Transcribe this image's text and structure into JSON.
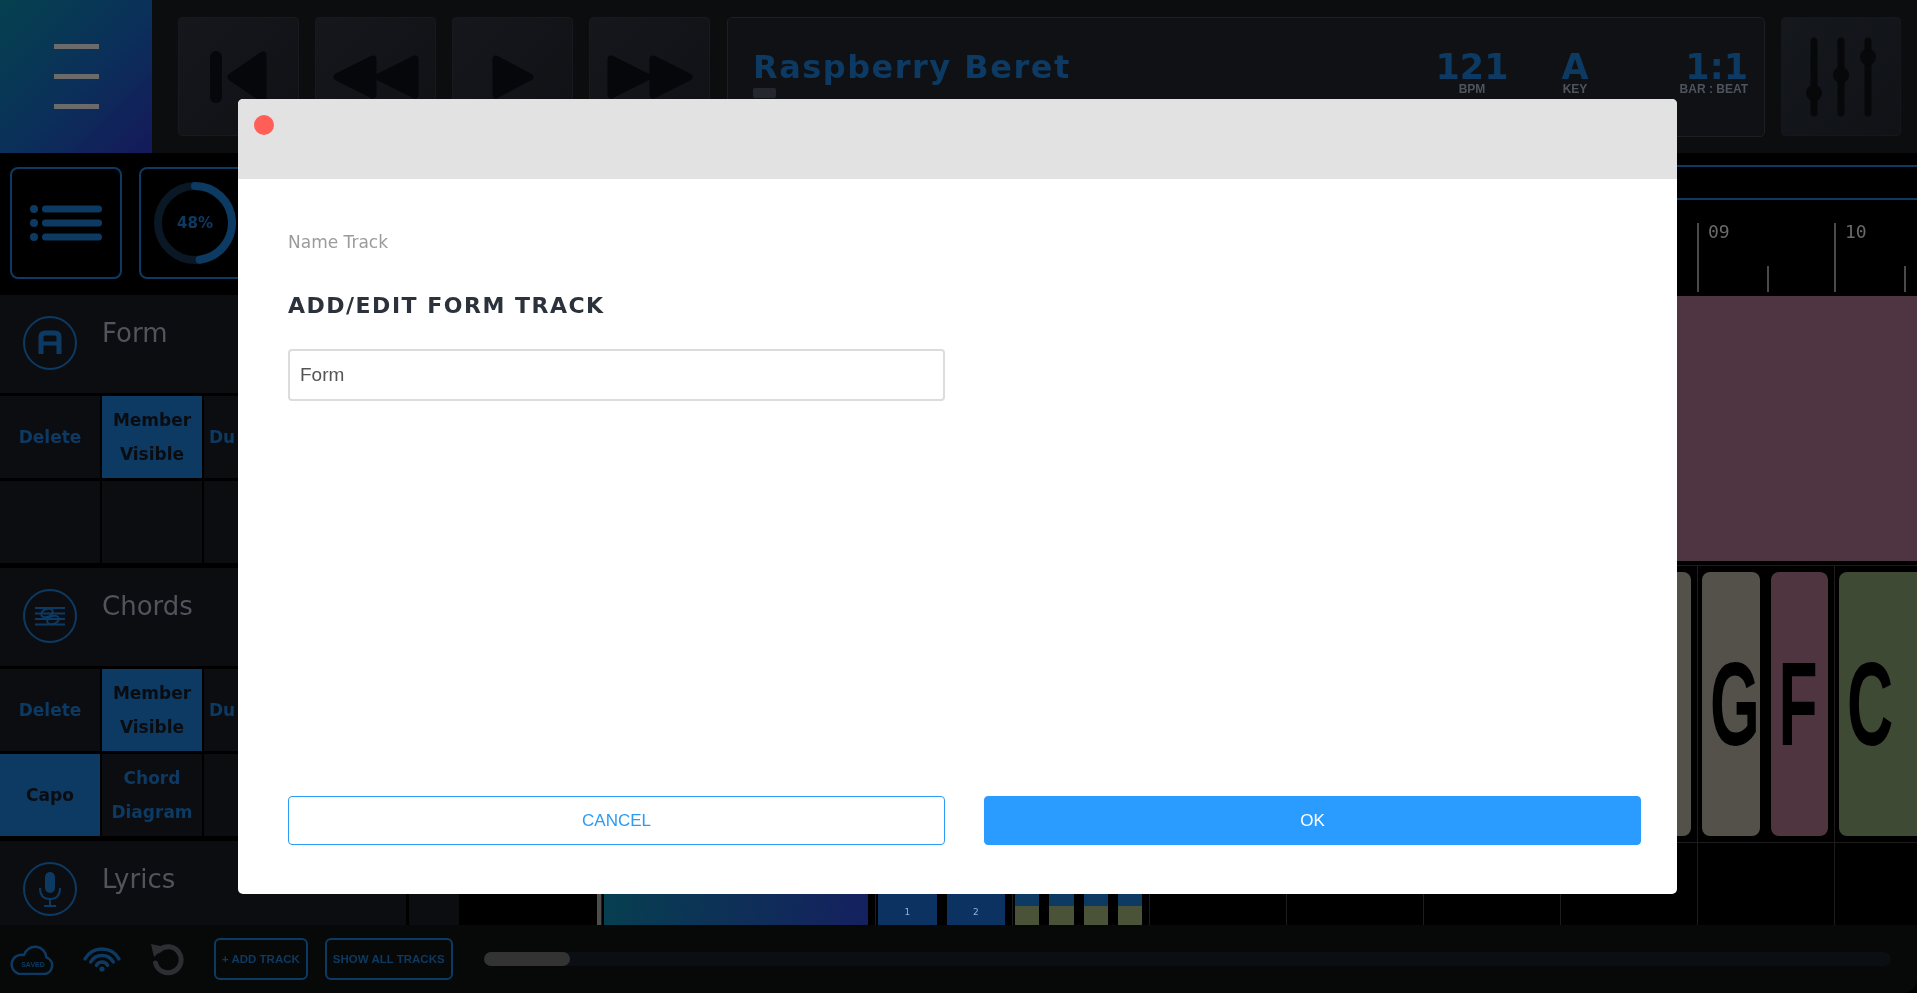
{
  "top_bar": {
    "song": {
      "title": "Raspberry Beret",
      "readouts": [
        {
          "value": "121",
          "label": "BPM"
        },
        {
          "value": "A",
          "label": "KEY"
        },
        {
          "value": "1:1",
          "label": "BAR : BEAT"
        }
      ]
    }
  },
  "sidebar": {
    "load": {
      "level": 0.48,
      "reading": "48%"
    },
    "tracks": [
      {
        "kind": "form",
        "name": "Form",
        "option_rows": [
          [
            {
              "label": "Delete",
              "on": false
            },
            {
              "label": "Member Visible",
              "on": true
            },
            {
              "label": "Du",
              "on": false
            }
          ],
          [
            {
              "on": false
            },
            {
              "on": false
            },
            {
              "on": false
            }
          ]
        ]
      },
      {
        "kind": "chords",
        "name": "Chords",
        "option_rows": [
          [
            {
              "label": "Delete",
              "on": false
            },
            {
              "label": "Member Visible",
              "on": true
            },
            {
              "label": "Du",
              "on": false
            }
          ],
          [
            {
              "label": "Capo",
              "on": true
            },
            {
              "label": "Chord Diagram",
              "on": false
            },
            {
              "on": false
            }
          ]
        ]
      },
      {
        "kind": "lyrics",
        "name": "Lyrics"
      }
    ]
  },
  "timeline": {
    "bars": [
      {
        "label": "09"
      },
      {
        "label": "10"
      }
    ],
    "chords": [
      {
        "color": "#535149"
      },
      {
        "label": "G",
        "color": "#535149"
      },
      {
        "label": "F",
        "color": "#4e3540"
      },
      {
        "label": "C",
        "color": "#3f4a35"
      }
    ],
    "clips": [
      {
        "kind": "section"
      },
      {
        "kind": "numbered",
        "label": "1"
      },
      {
        "kind": "numbered",
        "label": "2"
      },
      {
        "kind": "beat"
      },
      {
        "kind": "beat"
      },
      {
        "kind": "beat"
      },
      {
        "kind": "beat"
      }
    ]
  },
  "bottom_bar": {
    "sync_status": "SAVED",
    "buttons": [
      "+ ADD TRACK",
      "SHOW ALL TRACKS"
    ]
  },
  "dialog": {
    "field_label": "Name Track",
    "heading": "ADD/EDIT FORM TRACK",
    "name_field": {
      "value": "Form"
    },
    "buttons": [
      {
        "label": "CANCEL",
        "kind": "secondary"
      },
      {
        "label": "OK",
        "kind": "primary"
      }
    ]
  }
}
